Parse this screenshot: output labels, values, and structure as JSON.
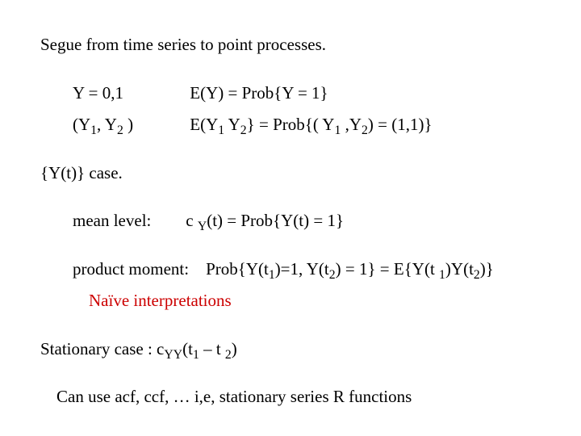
{
  "title": "Segue from time series to point processes.",
  "line1_y": "Y = 0,1",
  "line1_e": "E(Y) = Prob{Y = 1}",
  "line2_pair_open": "(Y",
  "line2_pair_mid": ", Y",
  "line2_pair_close": " )",
  "line2_e_open": "E(Y",
  "line2_e_mid": " Y",
  "line2_e_close": "}  =  Prob{( Y",
  "line2_comma": " ,Y",
  "line2_end": ") = (1,1)}",
  "ycase": "{Y(t)} case.",
  "meanlevel_label": "mean level:",
  "meanlevel_c": "c ",
  "meanlevel_rest": "(t) = Prob{Y(t) = 1}",
  "prodmom_label": "product moment:",
  "prodmom_p1": "Prob{Y(t",
  "prodmom_p2": ")=1,  Y(t",
  "prodmom_p3": ") = 1} = E{Y(t ",
  "prodmom_p4": ")Y(t",
  "prodmom_p5": ")}",
  "naive": "Naïve interpretations",
  "stationary_open": "Stationary case : c",
  "stationary_mid": "(t",
  "stationary_dash": " – t ",
  "stationary_close": ")",
  "lastline": "Can use acf, ccf, … i,e, stationary series R functions",
  "sub1": "1",
  "sub2": "2",
  "subY": "Y",
  "subYY": "YY"
}
